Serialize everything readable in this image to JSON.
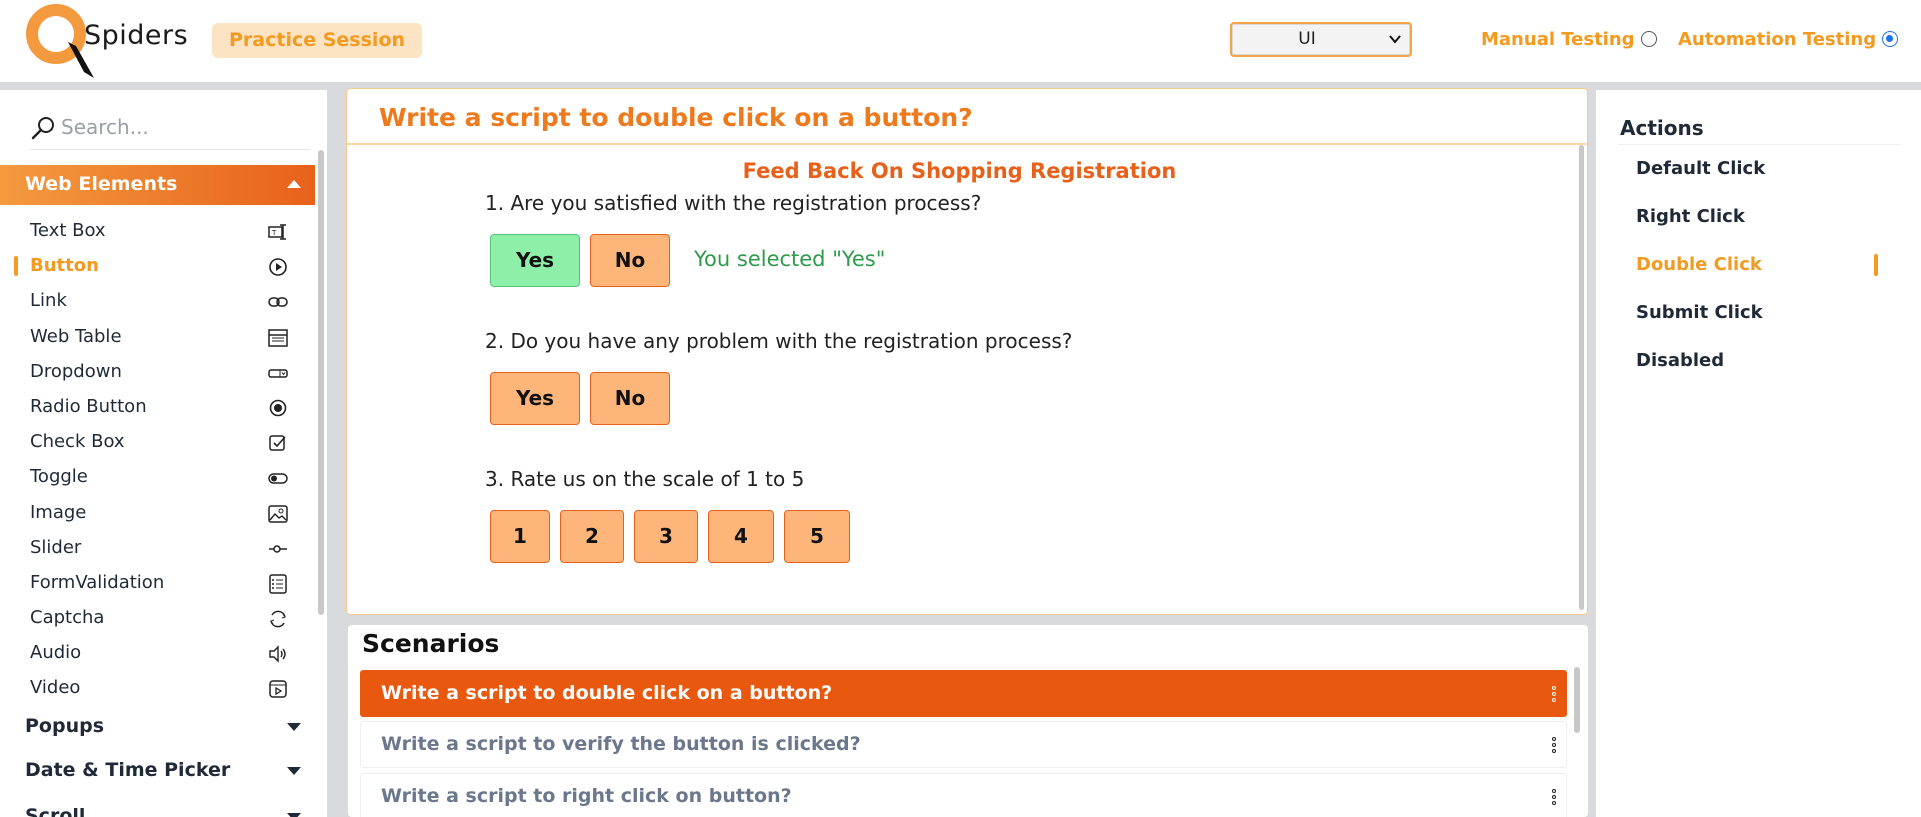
{
  "header": {
    "logo_text": "Spiders",
    "practice_label": "Practice Session",
    "dropdown_value": "UI",
    "manual_label": "Manual Testing",
    "automation_label": "Automation Testing",
    "selected_mode": "Automation Testing"
  },
  "sidebar": {
    "search_placeholder": "Search...",
    "section_open": "Web Elements",
    "items": [
      {
        "label": "Text Box",
        "icon": "textbox-icon"
      },
      {
        "label": "Button",
        "icon": "play-circle-icon",
        "active": true
      },
      {
        "label": "Link",
        "icon": "link-icon"
      },
      {
        "label": "Web Table",
        "icon": "table-icon"
      },
      {
        "label": "Dropdown",
        "icon": "dropdown-icon"
      },
      {
        "label": "Radio Button",
        "icon": "radio-icon"
      },
      {
        "label": "Check Box",
        "icon": "checkbox-icon"
      },
      {
        "label": "Toggle",
        "icon": "toggle-icon"
      },
      {
        "label": "Image",
        "icon": "image-icon"
      },
      {
        "label": "Slider",
        "icon": "slider-icon"
      },
      {
        "label": "FormValidation",
        "icon": "form-icon"
      },
      {
        "label": "Captcha",
        "icon": "captcha-icon"
      },
      {
        "label": "Audio",
        "icon": "audio-icon"
      },
      {
        "label": "Video",
        "icon": "video-icon"
      }
    ],
    "sections_closed": [
      "Popups",
      "Date & Time Picker",
      "Scroll"
    ]
  },
  "main": {
    "title": "Write a script to double click on a button?",
    "form_title": "Feed Back On Shopping Registration",
    "q1": "1. Are you satisfied with the registration process?",
    "q1_yes": "Yes",
    "q1_no": "No",
    "q1_selected": "Yes",
    "q1_message": "You selected \"Yes\"",
    "q2": "2. Do you have any problem with the registration process?",
    "q2_yes": "Yes",
    "q2_no": "No",
    "q3": "3. Rate us on the scale of 1 to 5",
    "ratings": [
      "1",
      "2",
      "3",
      "4",
      "5"
    ]
  },
  "scenarios": {
    "title": "Scenarios",
    "items": [
      "Write a script to double click on a button?",
      "Write a script to verify the button is clicked?",
      "Write a script to right click on button?"
    ],
    "active_index": 0
  },
  "actions": {
    "title": "Actions",
    "items": [
      "Default Click",
      "Right Click",
      "Double Click",
      "Submit Click",
      "Disabled"
    ],
    "active": "Double Click"
  },
  "colors": {
    "accent": "#f39a21",
    "primary_orange": "#e8611a",
    "button_fill": "#fdb57a",
    "selected_green": "#8ef0a8",
    "success_text": "#2e9b4b"
  }
}
